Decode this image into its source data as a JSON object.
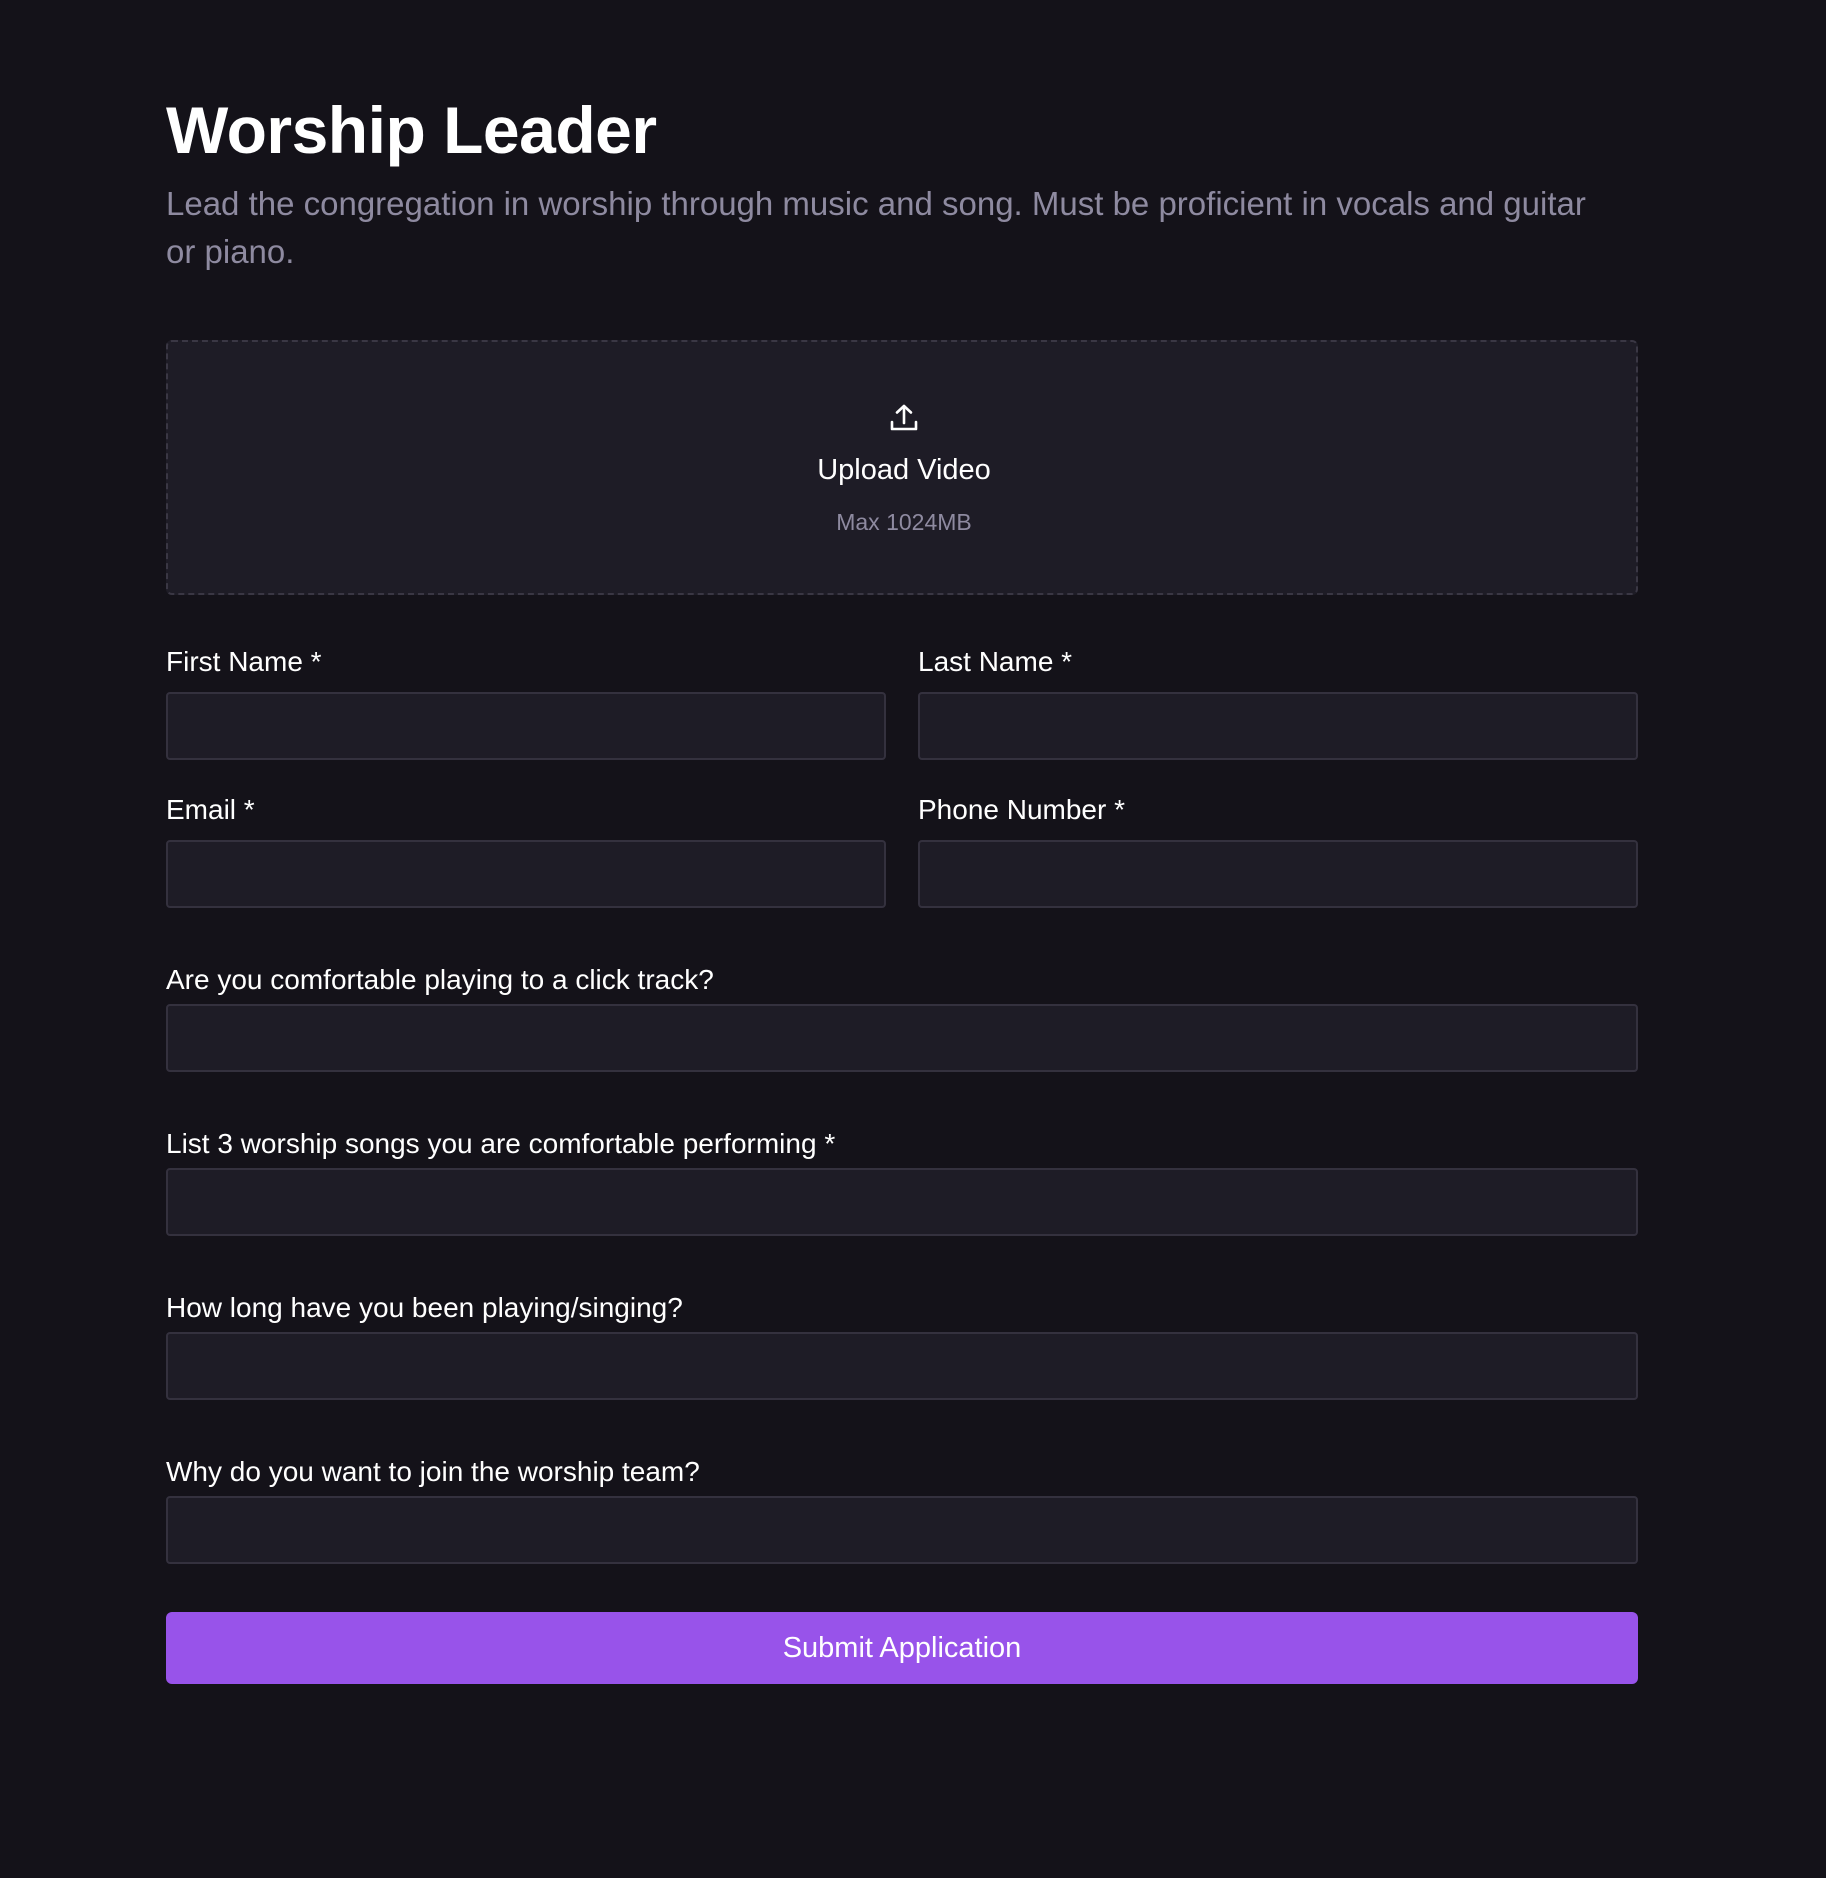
{
  "page": {
    "title": "Worship Leader",
    "description": "Lead the congregation in worship through music and song. Must be proficient in vocals and guitar or piano."
  },
  "upload": {
    "icon": "upload-icon",
    "title": "Upload Video",
    "subtitle": "Max 1024MB"
  },
  "form": {
    "first_name": {
      "label": "First Name *",
      "value": "",
      "placeholder": ""
    },
    "last_name": {
      "label": "Last Name *",
      "value": "",
      "placeholder": ""
    },
    "email": {
      "label": "Email *",
      "value": "",
      "placeholder": ""
    },
    "phone": {
      "label": "Phone Number *",
      "value": "",
      "placeholder": ""
    },
    "click_track": {
      "label": "Are you comfortable playing to a click track?",
      "value": "",
      "placeholder": ""
    },
    "songs": {
      "label": "List 3 worship songs you are comfortable performing *",
      "value": "",
      "placeholder": ""
    },
    "experience": {
      "label": "How long have you been playing/singing?",
      "value": "",
      "placeholder": ""
    },
    "motivation": {
      "label": "Why do you want to join the worship team?",
      "value": "",
      "placeholder": ""
    }
  },
  "submit": {
    "label": "Submit Application"
  },
  "colors": {
    "background": "#141219",
    "input_background": "#1e1c26",
    "input_border": "#34313e",
    "muted_text": "#8e8aa0",
    "accent": "#9853ea"
  }
}
